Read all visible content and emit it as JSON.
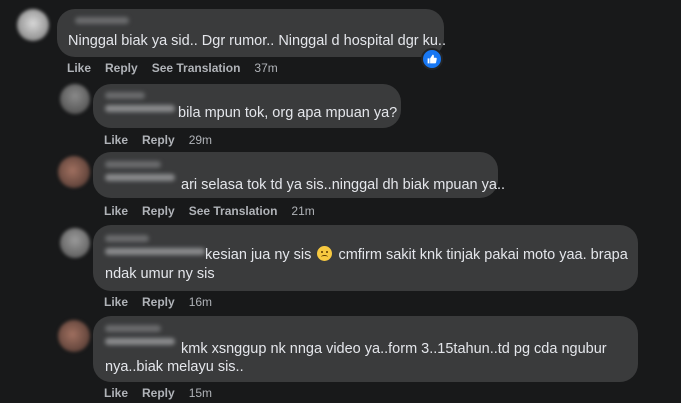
{
  "comments": [
    {
      "text": "Ninggal biak ya sid.. Dgr rumor.. Ninggal d hospital dgr ku..",
      "like": "Like",
      "reply": "Reply",
      "see_translation": "See Translation",
      "time": "37m",
      "has_like_reaction": true
    },
    {
      "text": "bila mpun tok, org apa mpuan ya?",
      "like": "Like",
      "reply": "Reply",
      "time": "29m"
    },
    {
      "text": "ari selasa tok td ya sis..ninggal dh biak mpuan ya..",
      "like": "Like",
      "reply": "Reply",
      "see_translation": "See Translation",
      "time": "21m"
    },
    {
      "text_before_emoji": "kesian jua ny sis",
      "emoji": "sad-face-emoji",
      "text_after_emoji": "cmfirm sakit knk tinjak pakai moto yaa. brapa",
      "text_line2": "ndak umur ny sis",
      "like": "Like",
      "reply": "Reply",
      "time": "16m"
    },
    {
      "text_line1": "kmk xsnggup nk nnga video ya..form 3..15tahun..td pg cda ngubur",
      "text_line2": "nya..biak melayu sis..",
      "like": "Like",
      "reply": "Reply",
      "time": "15m"
    }
  ],
  "colors": {
    "background": "#18191a",
    "bubble": "#3a3b3c",
    "text": "#e4e6eb",
    "secondary_text": "#b0b3b8",
    "like_blue": "#1877f2"
  }
}
